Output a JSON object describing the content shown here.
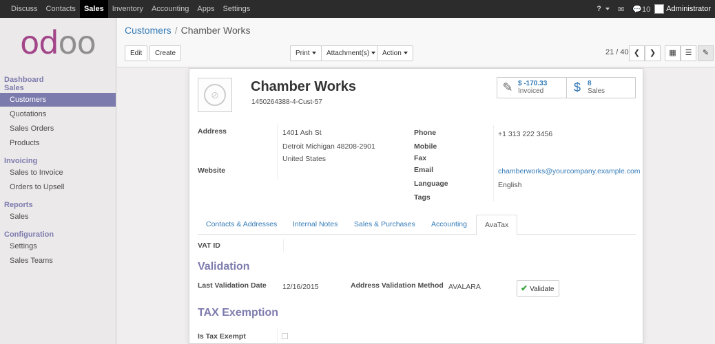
{
  "topbar": {
    "menu": [
      "Discuss",
      "Contacts",
      "Sales",
      "Inventory",
      "Accounting",
      "Apps",
      "Settings"
    ],
    "active_index": 2,
    "help": "?",
    "messages_count": "10",
    "user": "Administrator"
  },
  "sidebar": {
    "logo": "odoo",
    "sections": [
      {
        "title": "Dashboard",
        "items": []
      },
      {
        "title": "Sales",
        "items": [
          "Customers",
          "Quotations",
          "Sales Orders",
          "Products"
        ]
      },
      {
        "title": "Invoicing",
        "items": [
          "Sales to Invoice",
          "Orders to Upsell"
        ]
      },
      {
        "title": "Reports",
        "items": [
          "Sales"
        ]
      },
      {
        "title": "Configuration",
        "items": [
          "Settings",
          "Sales Teams"
        ]
      }
    ],
    "active_item": "Customers"
  },
  "breadcrumb": {
    "parent": "Customers",
    "separator": "/",
    "current": "Chamber Works"
  },
  "toolbar": {
    "edit": "Edit",
    "create": "Create",
    "print": "Print",
    "attachments": "Attachment(s)",
    "action": "Action",
    "pager": "21 / 40"
  },
  "record": {
    "name": "Chamber Works",
    "ref": "1450264388-4-Cust-57",
    "stats": [
      {
        "value": "$ -170.33",
        "label": "Invoiced"
      },
      {
        "value": "8",
        "label": "Sales"
      }
    ],
    "labels": {
      "address": "Address",
      "website": "Website",
      "phone": "Phone",
      "mobile": "Mobile",
      "fax": "Fax",
      "email": "Email",
      "language": "Language",
      "tags": "Tags"
    },
    "address_lines": [
      "1401 Ash St",
      "Detroit  Michigan  48208-2901",
      "United States"
    ],
    "phone": "+1 313 222 3456",
    "email": "chamberworks@yourcompany.example.com",
    "language": "English"
  },
  "tabs": [
    "Contacts & Addresses",
    "Internal Notes",
    "Sales & Purchases",
    "Accounting",
    "AvaTax"
  ],
  "active_tab": "AvaTax",
  "avatax": {
    "vat_label": "VAT ID",
    "validation_heading": "Validation",
    "last_validation_label": "Last Validation Date",
    "last_validation_value": "12/16/2015",
    "method_label": "Address Validation Method",
    "method_value": "AVALARA",
    "validate_button": "Validate",
    "tax_exemption_heading": "TAX Exemption",
    "tax_exempt_label": "Is Tax Exempt",
    "tax_exempt_checked": false
  },
  "colors": {
    "accent": "#7c7bad",
    "link": "#337ab7",
    "topbar": "#2c2c2c",
    "brand": "#a24689"
  }
}
